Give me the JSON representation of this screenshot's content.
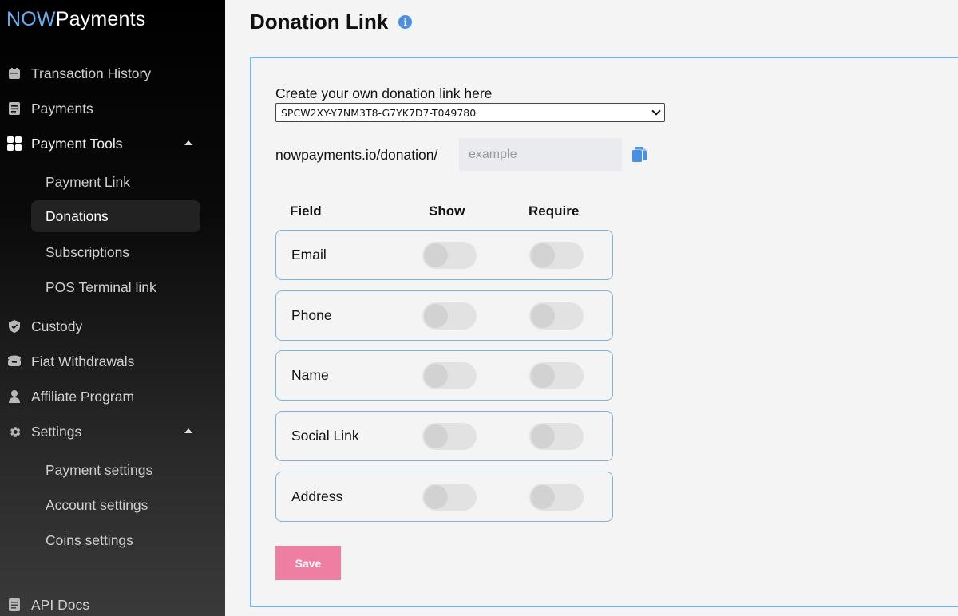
{
  "brand": {
    "now": "NOW",
    "payments": "Payments",
    "accent": "#64aef0"
  },
  "sidebar": {
    "items": [
      {
        "label": "Transaction History",
        "icon": "calendar-icon"
      },
      {
        "label": "Payments",
        "icon": "document-icon"
      },
      {
        "label": "Payment Tools",
        "icon": "grid-icon",
        "expanded": true
      },
      {
        "label": "Custody",
        "icon": "shield-icon"
      },
      {
        "label": "Fiat Withdrawals",
        "icon": "wallet-icon"
      },
      {
        "label": "Affiliate Program",
        "icon": "user-icon"
      },
      {
        "label": "Settings",
        "icon": "gear-icon",
        "expanded": true
      },
      {
        "label": "API Docs",
        "icon": "document-icon"
      }
    ],
    "payment_tools_sub": [
      "Payment Link",
      "Donations",
      "Subscriptions",
      "POS Terminal link"
    ],
    "settings_sub": [
      "Payment settings",
      "Account settings",
      "Coins settings"
    ],
    "active_sub": "Donations"
  },
  "page": {
    "title": "Donation Link"
  },
  "form": {
    "create_label": "Create your own donation link here",
    "selected_key": "SPCW2XY-Y7NM3T8-G7YK7D7-T049780",
    "url_prefix": "nowpayments.io/donation/",
    "url_placeholder": "example",
    "columns": {
      "field": "Field",
      "show": "Show",
      "require": "Require"
    },
    "fields": [
      {
        "label": "Email",
        "show": false,
        "require": false
      },
      {
        "label": "Phone",
        "show": false,
        "require": false
      },
      {
        "label": "Name",
        "show": false,
        "require": false
      },
      {
        "label": "Social Link",
        "show": false,
        "require": false
      },
      {
        "label": "Address",
        "show": false,
        "require": false
      }
    ],
    "save_label": "Save",
    "save_color": "#ee7fa3"
  }
}
